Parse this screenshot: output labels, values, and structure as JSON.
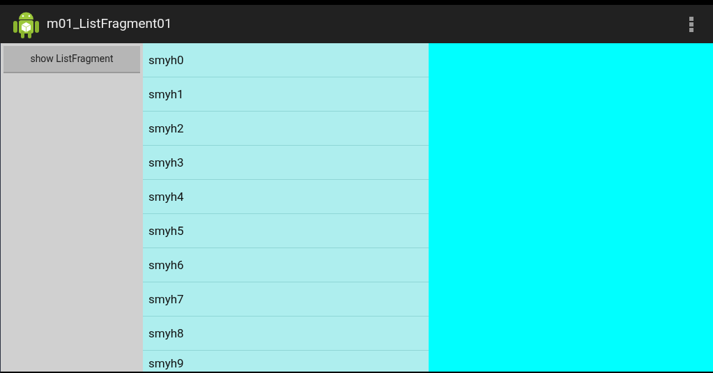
{
  "action_bar": {
    "title": "m01_ListFragment01"
  },
  "left_pane": {
    "button": "show ListFragment"
  },
  "list": {
    "items": [
      "smyh0",
      "smyh1",
      "smyh2",
      "smyh3",
      "smyh4",
      "smyh5",
      "smyh6",
      "smyh7",
      "smyh8",
      "smyh9"
    ]
  }
}
